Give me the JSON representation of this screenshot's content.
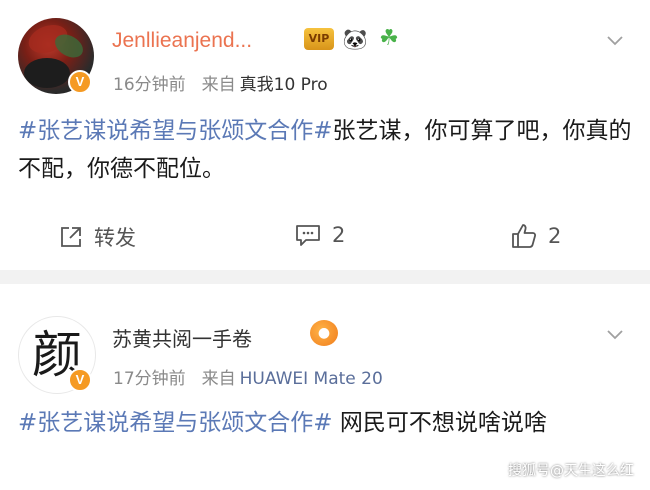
{
  "posts": [
    {
      "username": "Jenllieanjend...",
      "verified_badge": "V",
      "badges": [
        "crown-badge-icon",
        "panda-icon",
        "clover-icon"
      ],
      "crown_badge_text": "VIP",
      "time": "16分钟前",
      "source_prefix": "来自",
      "device": "真我10 Pro",
      "content_hashtag": "#张艺谋说希望与张颂文合作#",
      "content_text": "张艺谋，你可算了吧，你真的不配，你德不配位。",
      "actions": {
        "repost_label": "转发",
        "comment_count": "2",
        "like_count": "2"
      }
    },
    {
      "username": "苏黄共阅一手卷",
      "avatar_glyph": "颜",
      "verified_badge": "V",
      "badges": [
        "pufferfish-icon"
      ],
      "time": "17分钟前",
      "source_prefix": "来自",
      "device": "HUAWEI Mate 20",
      "content_hashtag": "#张艺谋说希望与张颂文合作#",
      "content_text": " 网民可不想说啥说啥"
    }
  ],
  "watermark": "搜狐号@天生这么红",
  "colors": {
    "username_orange": "#eb7350",
    "hashtag_blue": "#5b79b6",
    "meta_gray": "#8a8a8a",
    "verified_orange": "#f59a23",
    "separator": "#f2f2f2"
  }
}
